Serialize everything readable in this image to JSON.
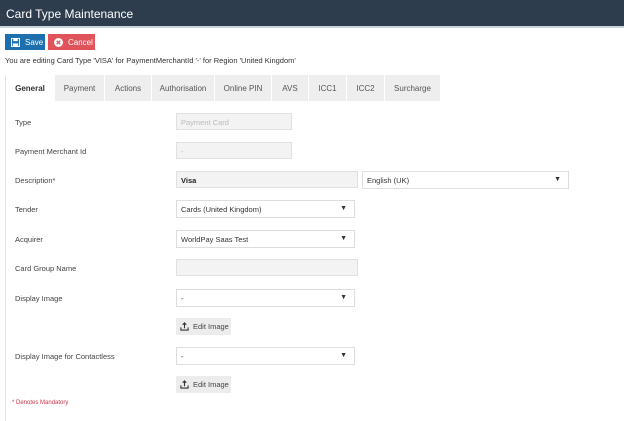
{
  "header": {
    "title": "Card Type Maintenance"
  },
  "toolbar": {
    "save_label": "Save",
    "cancel_label": "Cancel"
  },
  "editing_text": "You are editing Card Type 'VISA' for PaymentMerchantId '-' for Region 'United Kingdom'",
  "tabs": [
    "General",
    "Payment",
    "Actions",
    "Authorisation",
    "Online PIN",
    "AVS",
    "ICC1",
    "ICC2",
    "Surcharge"
  ],
  "form": {
    "type": {
      "label": "Type",
      "placeholder": "Payment Card"
    },
    "merchant": {
      "label": "Payment Merchant Id",
      "placeholder": "-"
    },
    "description": {
      "label": "Description*",
      "value": "Visa",
      "language": "English (UK)"
    },
    "tender": {
      "label": "Tender",
      "value": "Cards (United Kingdom)"
    },
    "acquirer": {
      "label": "Acquirer",
      "value": "WorldPay Saas Test"
    },
    "card_group": {
      "label": "Card Group Name",
      "value": ""
    },
    "display_image": {
      "label": "Display Image",
      "value": "-",
      "edit_label": "Edit Image"
    },
    "display_image_contactless": {
      "label": "Display Image for Contactless",
      "value": "-",
      "edit_label": "Edit Image"
    }
  },
  "mandatory_note": "* Denotes Mandatory",
  "colors": {
    "header": "#2e3d4d",
    "save": "#1d6fae",
    "cancel": "#e0535a"
  }
}
